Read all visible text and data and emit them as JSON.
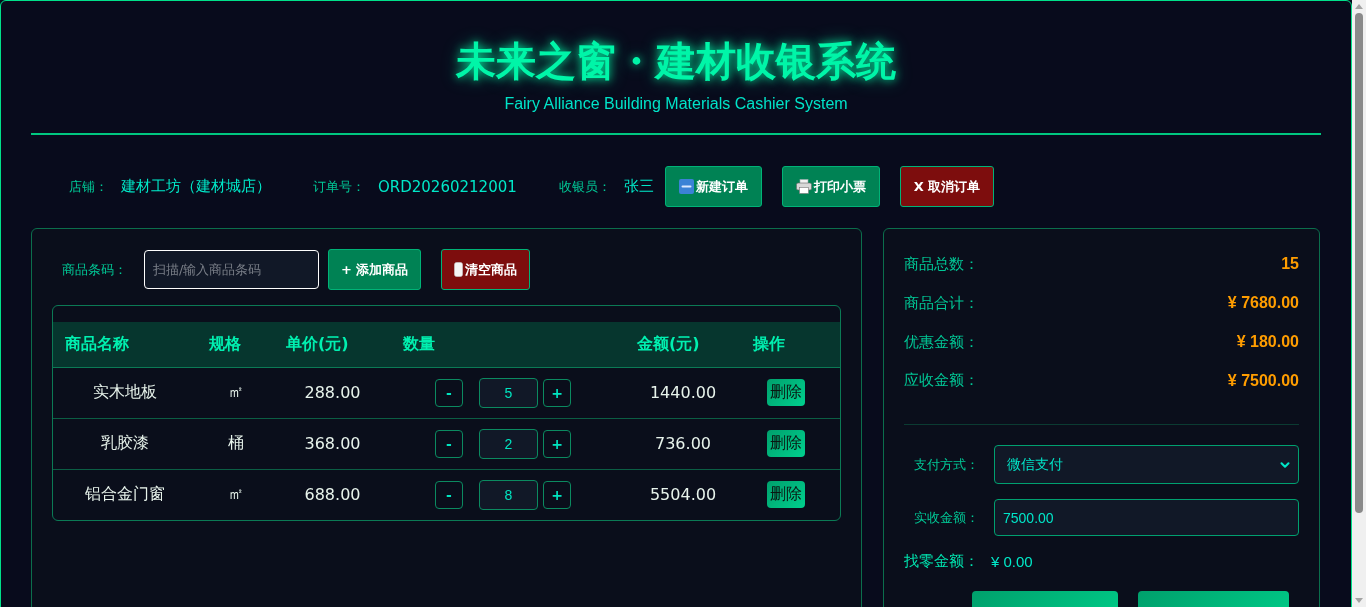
{
  "header": {
    "title": "未来之窗・建材收银系统",
    "subtitle": "Fairy Alliance Building Materials Cashier System"
  },
  "order_info": [
    {
      "label": "店铺：",
      "value": "建材工坊（建材城店）"
    },
    {
      "label": "订单号：",
      "value": "ORD20260212001"
    },
    {
      "label": "收银员：",
      "value": "张三"
    }
  ],
  "order_actions": [
    {
      "kind": "new",
      "label": "新建订单"
    },
    {
      "kind": "print",
      "label": "打印小票"
    },
    {
      "kind": "cancel",
      "label": "X 取消订单"
    }
  ],
  "barcode": {
    "label": "商品条码：",
    "placeholder": "扫描/输入商品条码",
    "focused": true
  },
  "cart_actions": [
    {
      "kind": "add",
      "label": "+ 添加商品"
    },
    {
      "kind": "clear",
      "label": "清空商品"
    }
  ],
  "table": {
    "columns": [
      "商品名称",
      "规格",
      "单价(元)",
      "数量",
      "金额(元)",
      "操作"
    ],
    "rows": [
      {
        "name": "实木地板",
        "spec": "㎡",
        "price": "288.00",
        "decrease": "-",
        "quantity": "5",
        "increase": "+",
        "amount": "1440.00",
        "action": "删除"
      },
      {
        "name": "乳胶漆",
        "spec": "桶",
        "price": "368.00",
        "decrease": "-",
        "quantity": "2",
        "increase": "+",
        "amount": "736.00",
        "action": "删除"
      },
      {
        "name": "铝合金门窗",
        "spec": "㎡",
        "price": "688.00",
        "decrease": "-",
        "quantity": "8",
        "increase": "+",
        "amount": "5504.00",
        "action": "删除"
      }
    ]
  },
  "summary": [
    {
      "label": "商品总数：",
      "value": "15"
    },
    {
      "label": "商品合计：",
      "value": "¥ 7680.00"
    },
    {
      "label": "优惠金额：",
      "value": "¥ 180.00"
    },
    {
      "label": "应收金额：",
      "value": "¥ 7500.00"
    }
  ],
  "payment": {
    "method_label": "支付方式：",
    "method": "微信支付",
    "received_label": "实收金额：",
    "received": "7500.00"
  },
  "change": {
    "label": "找零金额：",
    "value": "¥ 0.00"
  }
}
